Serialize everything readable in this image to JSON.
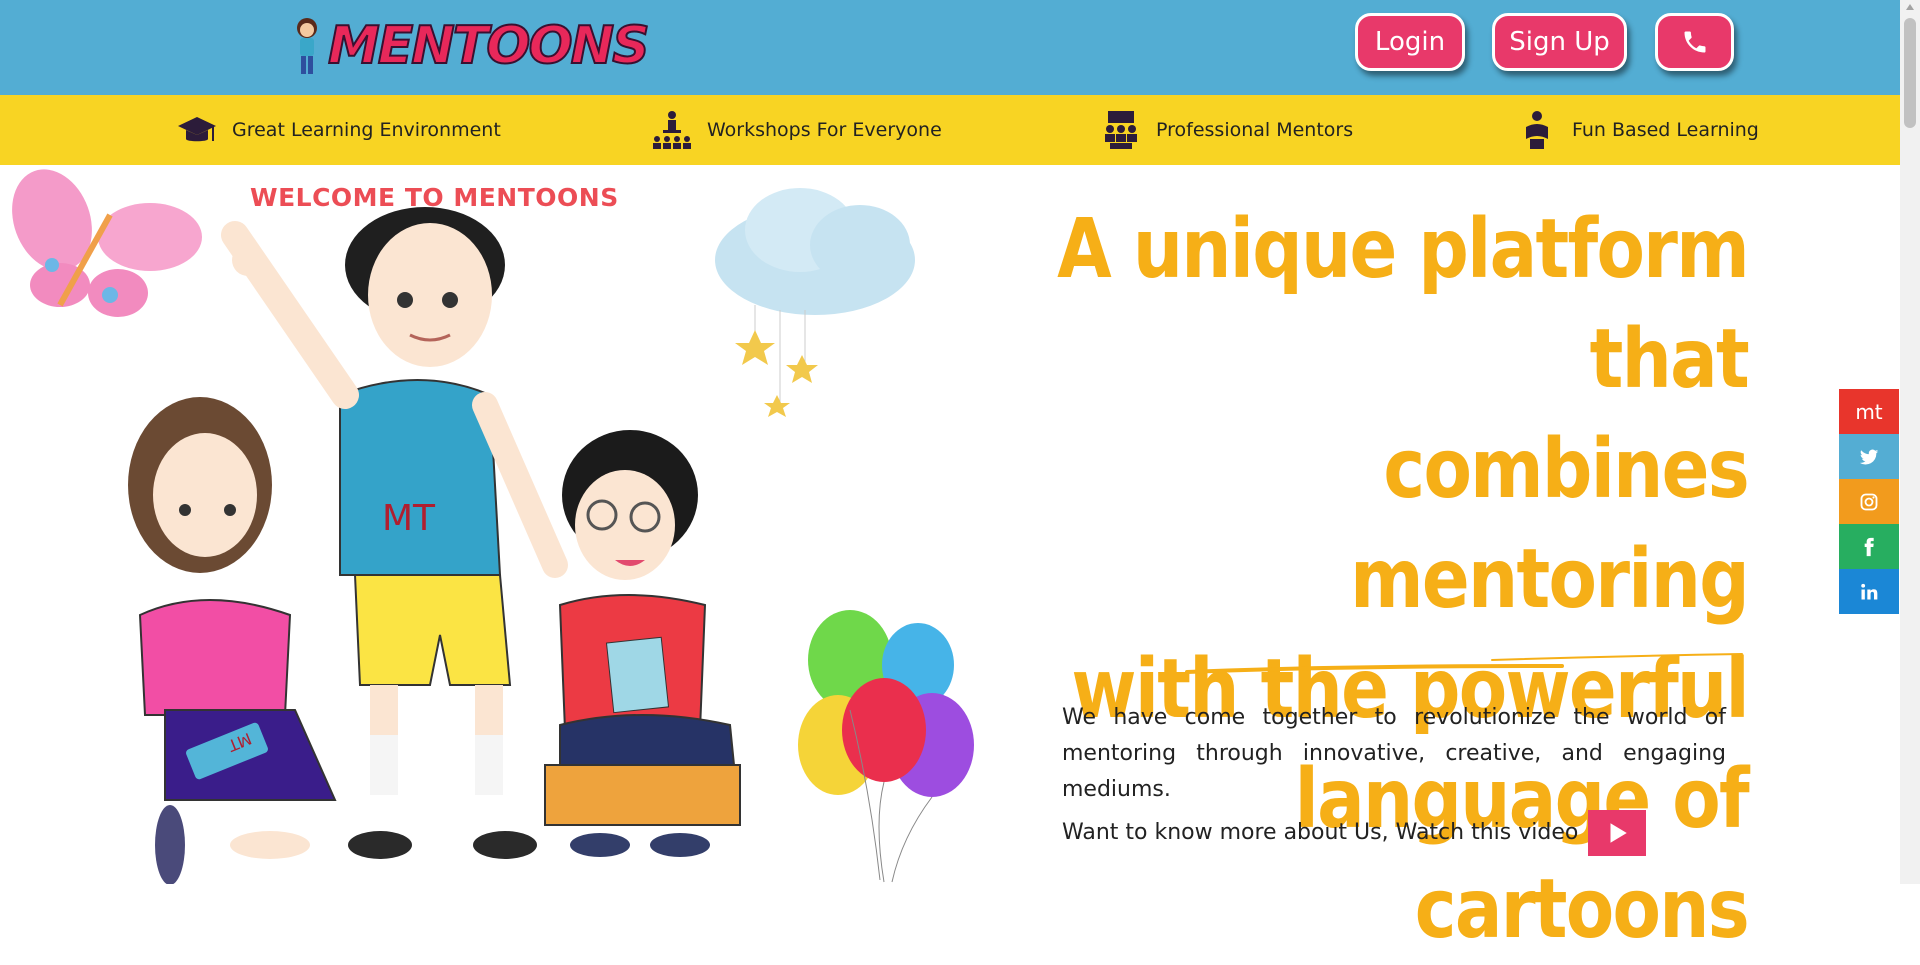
{
  "header": {
    "logo_text": "MENTOONS",
    "login_label": "Login",
    "signup_label": "Sign Up",
    "phone_icon": "phone-icon",
    "bg_color": "#53add3",
    "button_color": "#e8396a"
  },
  "nav": {
    "bg_color": "#f8d423",
    "items": [
      {
        "label": "Great Learning Environment",
        "icon": "graduation-cap-icon"
      },
      {
        "label": "Workshops For Everyone",
        "icon": "workshop-icon"
      },
      {
        "label": "Professional Mentors",
        "icon": "mentors-icon"
      },
      {
        "label": "Fun Based Learning",
        "icon": "reading-icon"
      }
    ]
  },
  "hero": {
    "welcome": "WELCOME TO MENTOONS",
    "headline_lines": [
      "A unique platform that",
      "combines mentoring",
      "with the powerful",
      "language of cartoons"
    ],
    "headline_color": "#f6af17",
    "paragraph": "We have come together to revolutionize the world of mentoring through innovative, creative, and engaging mediums.",
    "video_text": "Want to know more about Us, Watch this video",
    "shirt_text": "MT",
    "tablet_text": "MT"
  },
  "social": {
    "items": [
      {
        "label": "mt",
        "icon": "mentoons-icon",
        "color": "#e8352c"
      },
      {
        "label": "",
        "icon": "twitter-icon",
        "color": "#54add3"
      },
      {
        "label": "",
        "icon": "instagram-icon",
        "color": "#f29b1d"
      },
      {
        "label": "",
        "icon": "facebook-icon",
        "color": "#27ae60"
      },
      {
        "label": "",
        "icon": "linkedin-icon",
        "color": "#1b87d6"
      }
    ]
  }
}
